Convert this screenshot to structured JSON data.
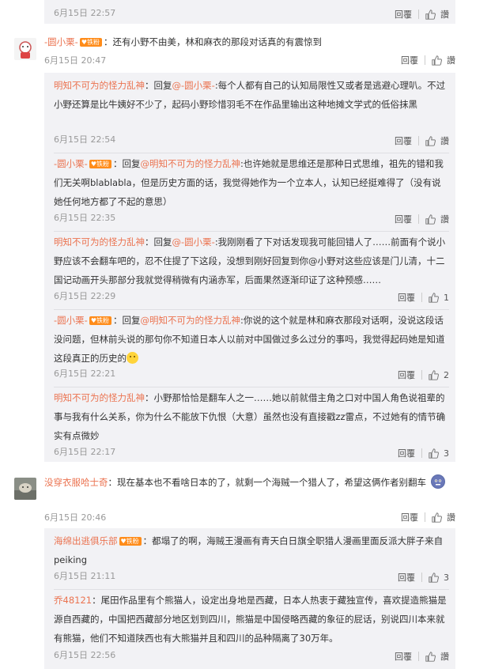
{
  "top": {
    "time": "6月15日 22:57",
    "reply": "回覆",
    "like": "讚"
  },
  "comment1": {
    "author": "-圆小栗-",
    "badge": "铁粉",
    "text": "：还有小野不由美，林和麻衣的那段对话真的有震惊到",
    "time": "6月15日 20:47",
    "reply": "回覆",
    "like": "讚",
    "replies": [
      {
        "author": "明知不可为的怪力乱神",
        "prefix": "：回复",
        "mention": "@-圆小栗-",
        "text": ":每个人都有自己的认知局限性又或者是逃避心理叭。不过小野还算是比牛姨好不少了，起码小野珍惜羽毛不在作品里输出这种地摊文学式的低俗抹黑",
        "time": "6月15日 22:54",
        "reply": "回覆",
        "like": "讚"
      },
      {
        "author": "-圆小栗-",
        "badge": "铁粉",
        "prefix": "：回复",
        "mention": "@明知不可为的怪力乱神",
        "text": ":也许她就是思维还是那种日式思维，祖先的错和我们无关啊blablabla，但是历史方面的话，我觉得她作为一个立本人，认知已经挺难得了（没有说她任何地方都了不起的意思）",
        "time": "6月15日 22:35",
        "reply": "回覆",
        "like": "讚"
      },
      {
        "author": "明知不可为的怪力乱神",
        "prefix": "：回复",
        "mention": "@-圆小栗-",
        "text": ":我刚刚看了下对话发现我可能回错人了……前面有个说小野应该不会翻车吧的，忍不住提了下这段，没想到刚好回复到你@小野对这些应该是门儿清，十二国记动画开头那部分我就觉得稍微有内涵赤军，后面果然逐渐印证了这种预感……",
        "time": "6月15日 22:29",
        "reply": "回覆",
        "like": "1"
      },
      {
        "author": "-圆小栗-",
        "badge": "铁粉",
        "prefix": "：回复",
        "mention": "@明知不可为的怪力乱神",
        "text": ":你说的这个就是林和麻衣那段对话啊，没说这段话没问题，但林前头说的那句你不知道日本人以前对中国做过多么过分的事吗，我觉得起码她是知道这段真正的历史的",
        "time": "6月15日 22:21",
        "reply": "回覆",
        "like": "2"
      },
      {
        "author": "明知不可为的怪力乱神",
        "prefix": "",
        "mention": "",
        "text": "：小野那恰恰是翻车人之一……她以前就借主角之口对中国人角色说祖辈的事与我有什么关系，你为什么不能放下仇恨（大意）虽然也没有直接戳zz雷点，不过她有的情节确实有点微妙",
        "time": "6月15日 22:17",
        "reply": "回覆",
        "like": "3"
      }
    ]
  },
  "comment2": {
    "author": "没穿衣服哈士奇",
    "text": "：现在基本也不看啥日本的了，就剩一个海贼一个猎人了，希望这俩作者别翻车",
    "time": "6月15日 20:46",
    "reply": "回覆",
    "like": "讚",
    "replies": [
      {
        "author": "海绵出逃俱乐部",
        "badge": "铁粉",
        "prefix": "",
        "mention": "",
        "text": "：都塌了的啊，海贼王漫画有青天白日旗全职猎人漫画里面反派大胖子来自peiking",
        "time": "6月15日 21:11",
        "reply": "回覆",
        "like": "3"
      },
      {
        "author": "乔48121",
        "prefix": "",
        "mention": "",
        "text": "：尾田作品里有个熊猫人，设定出身地是西藏，日本人热衷于藏独宣传，喜欢提造熊猫是源自西藏的，中国把西藏部分地区划到四川，熊猫是中国侵略西藏的象征的屁话，别说四川本来就有熊猫，他们不知道陕西也有大熊猫并且和四川的品种隔离了30万年。",
        "time": "6月15日 22:56",
        "reply": "回覆",
        "like": "讚"
      }
    ]
  }
}
